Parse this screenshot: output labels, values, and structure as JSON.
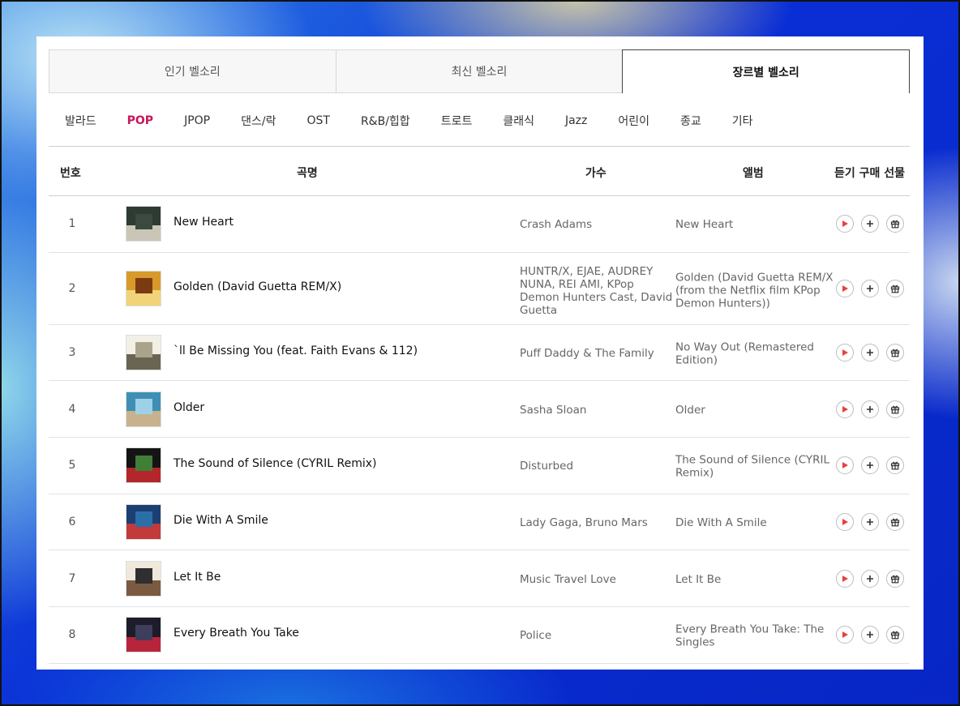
{
  "tabs": [
    {
      "label": "인기 벨소리",
      "active": false
    },
    {
      "label": "최신 벨소리",
      "active": false
    },
    {
      "label": "장르별 벨소리",
      "active": true
    }
  ],
  "genres": [
    {
      "label": "발라드",
      "active": false
    },
    {
      "label": "POP",
      "active": true
    },
    {
      "label": "JPOP",
      "active": false
    },
    {
      "label": "댄스/락",
      "active": false
    },
    {
      "label": "OST",
      "active": false
    },
    {
      "label": "R&B/힙합",
      "active": false
    },
    {
      "label": "트로트",
      "active": false
    },
    {
      "label": "클래식",
      "active": false
    },
    {
      "label": "Jazz",
      "active": false
    },
    {
      "label": "어린이",
      "active": false
    },
    {
      "label": "종교",
      "active": false
    },
    {
      "label": "기타",
      "active": false
    }
  ],
  "table": {
    "headers": {
      "number": "번호",
      "title": "곡명",
      "artist": "가수",
      "album": "앨범",
      "actions": "듣기 구매 선물"
    },
    "rows": [
      {
        "number": "1",
        "title": "New Heart",
        "artist": "Crash Adams",
        "album": "New Heart",
        "tall": false
      },
      {
        "number": "2",
        "title": "Golden (David Guetta REM/X)",
        "artist": "HUNTR/X, EJAE, AUDREY NUNA, REI AMI, KPop Demon Hunters Cast, David Guetta",
        "album": "Golden (David Guetta REM/X (from the Netflix film KPop Demon Hunters))",
        "tall": true
      },
      {
        "number": "3",
        "title": "`ll Be Missing You (feat. Faith Evans & 112)",
        "artist": "Puff Daddy & The Family",
        "album": "No Way Out (Remastered Edition)",
        "tall": false
      },
      {
        "number": "4",
        "title": "Older",
        "artist": "Sasha Sloan",
        "album": "Older",
        "tall": false
      },
      {
        "number": "5",
        "title": "The Sound of Silence (CYRIL Remix)",
        "artist": "Disturbed",
        "album": "The Sound of Silence (CYRIL Remix)",
        "tall": false
      },
      {
        "number": "6",
        "title": "Die With A Smile",
        "artist": "Lady Gaga, Bruno Mars",
        "album": "Die With A Smile",
        "tall": false
      },
      {
        "number": "7",
        "title": "Let It Be",
        "artist": "Music Travel Love",
        "album": "Let It Be",
        "tall": false
      },
      {
        "number": "8",
        "title": "Every Breath You Take",
        "artist": "Police",
        "album": "Every Breath You Take: The Singles",
        "tall": false
      }
    ]
  },
  "icons": {
    "play": "play-icon",
    "add": "plus-icon",
    "gift": "gift-icon"
  },
  "colors": {
    "accent": "#c6175a",
    "play": "#e8413c",
    "background": "#0a2fd6"
  }
}
